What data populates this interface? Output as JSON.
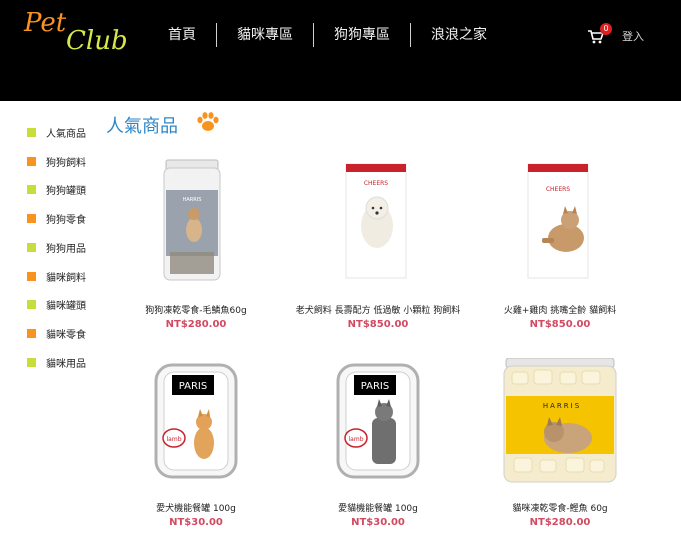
{
  "header": {
    "logo_left": "Pet",
    "logo_right": "Club",
    "nav": [
      "首頁",
      "貓咪專區",
      "狗狗專區",
      "浪浪之家"
    ],
    "cart_count": "0",
    "login_label": "登入"
  },
  "sidebar": {
    "items": [
      {
        "label": "人氣商品",
        "color": "#c8dc3c"
      },
      {
        "label": "狗狗飼料",
        "color": "#f7931e"
      },
      {
        "label": "狗狗罐頭",
        "color": "#c8dc3c"
      },
      {
        "label": "狗狗零食",
        "color": "#f7931e"
      },
      {
        "label": "狗狗用品",
        "color": "#c8dc3c"
      },
      {
        "label": "貓咪飼料",
        "color": "#f7931e"
      },
      {
        "label": "貓咪罐頭",
        "color": "#c8dc3c"
      },
      {
        "label": "貓咪零食",
        "color": "#f7931e"
      },
      {
        "label": "貓咪用品",
        "color": "#c8dc3c"
      }
    ]
  },
  "main": {
    "section_title": "人氣商品",
    "products": [
      {
        "name": "狗狗凍乾零食-毛鱗魚60g",
        "price": "NT$280.00",
        "brand": "HARRIS"
      },
      {
        "name": "老犬飼料 長壽配方 低過敏 小顆粒 狗飼料",
        "price": "NT$850.00",
        "brand": "CHEERS"
      },
      {
        "name": "火雞+雞肉 挑嘴全齡 貓飼料",
        "price": "NT$850.00",
        "brand": "CHEERS"
      },
      {
        "name": "愛犬機能餐罐 100g",
        "price": "NT$30.00",
        "brand": "PARIS",
        "tag": "lamb"
      },
      {
        "name": "愛貓機能餐罐 100g",
        "price": "NT$30.00",
        "brand": "PARIS",
        "tag": "lamb"
      },
      {
        "name": "貓咪凍乾零食-鰹魚 60g",
        "price": "NT$280.00",
        "brand": "HARRIS"
      }
    ]
  },
  "colors": {
    "header_bg": "#000000",
    "accent_orange": "#f7931e",
    "accent_green": "#c8dc3c",
    "title_blue": "#2e87c8",
    "price_pink": "#d24a62"
  }
}
